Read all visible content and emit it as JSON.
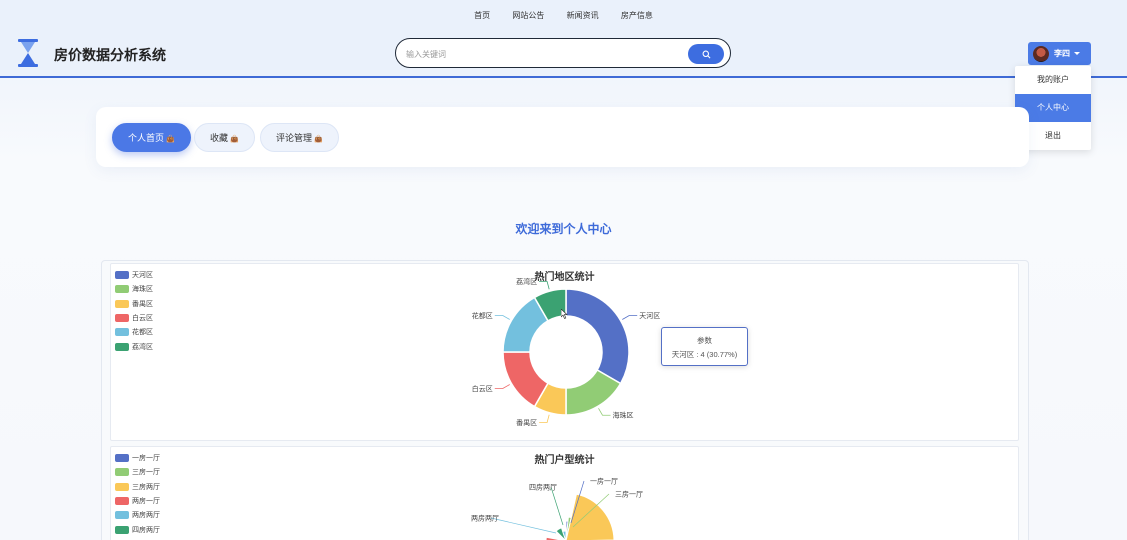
{
  "header": {
    "nav": [
      "首页",
      "网站公告",
      "新闻资讯",
      "房产信息"
    ],
    "title": "房价数据分析系统",
    "search": {
      "placeholder": "输入关键词"
    },
    "user": {
      "name": "李四"
    },
    "dropdown": [
      "我的账户",
      "个人中心",
      "退出"
    ]
  },
  "tabs": [
    {
      "label": "个人首页",
      "active": true
    },
    {
      "label": "收藏",
      "active": false
    },
    {
      "label": "评论管理",
      "active": false
    }
  ],
  "welcome": "欢迎来到个人中心",
  "colors": {
    "accent": "#4b78e6",
    "palette": [
      "#5470c6",
      "#91cc75",
      "#fac858",
      "#ee6666",
      "#73c0de",
      "#3ba272"
    ]
  },
  "tooltip": {
    "title": "参数",
    "body": "天河区 : 4 (30.77%)"
  },
  "chart_data": [
    {
      "type": "pie",
      "title": "热门地区统计",
      "donut": true,
      "legend": "top-left",
      "slices": [
        {
          "name": "天河区",
          "value": 4
        },
        {
          "name": "海珠区",
          "value": 2
        },
        {
          "name": "番禺区",
          "value": 1
        },
        {
          "name": "白云区",
          "value": 2
        },
        {
          "name": "花都区",
          "value": 2
        },
        {
          "name": "荔湾区",
          "value": 1
        }
      ]
    },
    {
      "type": "pie",
      "title": "热门户型统计",
      "legend": "top-left",
      "legend_names": [
        "一房一厅",
        "三房一厅",
        "三房两厅",
        "两房一厅",
        "两房两厅",
        "四房两厅"
      ],
      "labels_visible": [
        "四房两厅",
        "一房一厅",
        "三房一厅",
        "两房两厅"
      ]
    }
  ]
}
